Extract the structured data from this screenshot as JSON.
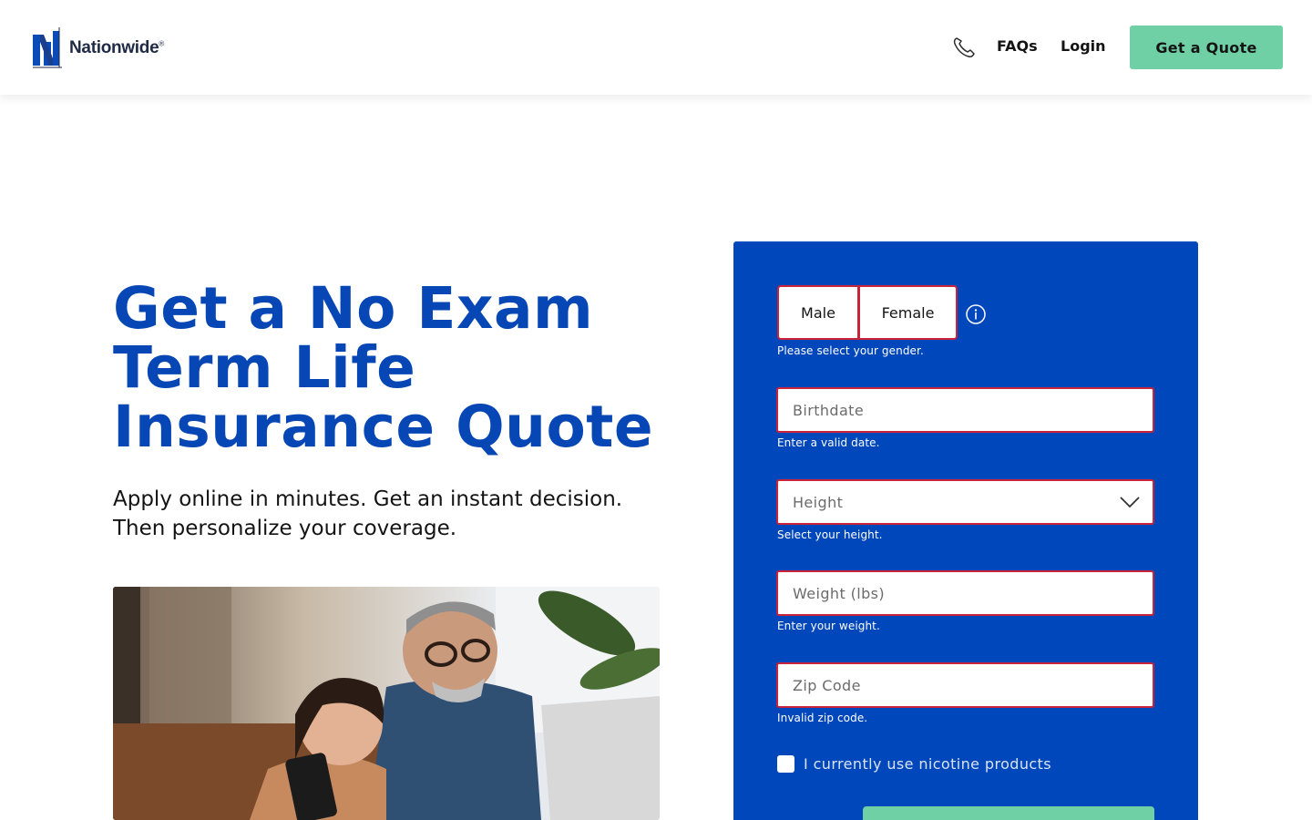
{
  "header": {
    "brand": "Nationwide",
    "brand_mark": "®",
    "nav": {
      "faqs": "FAQs",
      "login": "Login"
    },
    "cta": "Get a Quote"
  },
  "hero": {
    "headline_lines": [
      "Get a No Exam",
      "Term Life",
      "Insurance Quote"
    ],
    "subtitle": "Apply online in minutes. Get an instant decision. Then personalize your coverage."
  },
  "form": {
    "gender": {
      "male": "Male",
      "female": "Female",
      "error": "Please select your gender."
    },
    "birthdate": {
      "placeholder": "Birthdate",
      "error": "Enter a valid date."
    },
    "height": {
      "placeholder": "Height",
      "error": "Select your height."
    },
    "weight": {
      "placeholder": "Weight (lbs)",
      "error": "Enter your weight."
    },
    "zip": {
      "placeholder": "Zip Code",
      "error": "Invalid zip code."
    },
    "nicotine": {
      "label": "I currently use nicotine products",
      "checked": false
    }
  },
  "icons": {
    "phone": "phone-icon",
    "info": "info-icon",
    "chevron": "chevron-down-icon",
    "logo": "nationwide-logo-icon"
  },
  "colors": {
    "brand_blue": "#0047bb",
    "headline_blue": "#0747b5",
    "accent_green": "#6fd0a6",
    "error_red": "#c9233a"
  }
}
